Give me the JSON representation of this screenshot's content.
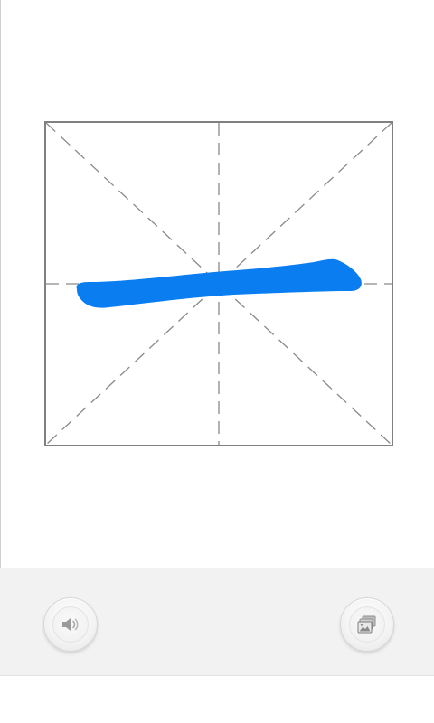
{
  "screen": {
    "background": "#ffffff",
    "accent_stroke_color": "#0a7ef0",
    "grid_line_color": "#808080",
    "guide_line_color": "#8a8a8a"
  },
  "character_grid": {
    "style": "mi-zi-ge",
    "character": "一",
    "stroke_color": "#0a7ef0"
  },
  "toolbar": {
    "background": "#f2f2f2",
    "buttons": [
      {
        "name": "speaker",
        "icon": "speaker-icon"
      },
      {
        "name": "gallery",
        "icon": "gallery-icon"
      }
    ]
  }
}
